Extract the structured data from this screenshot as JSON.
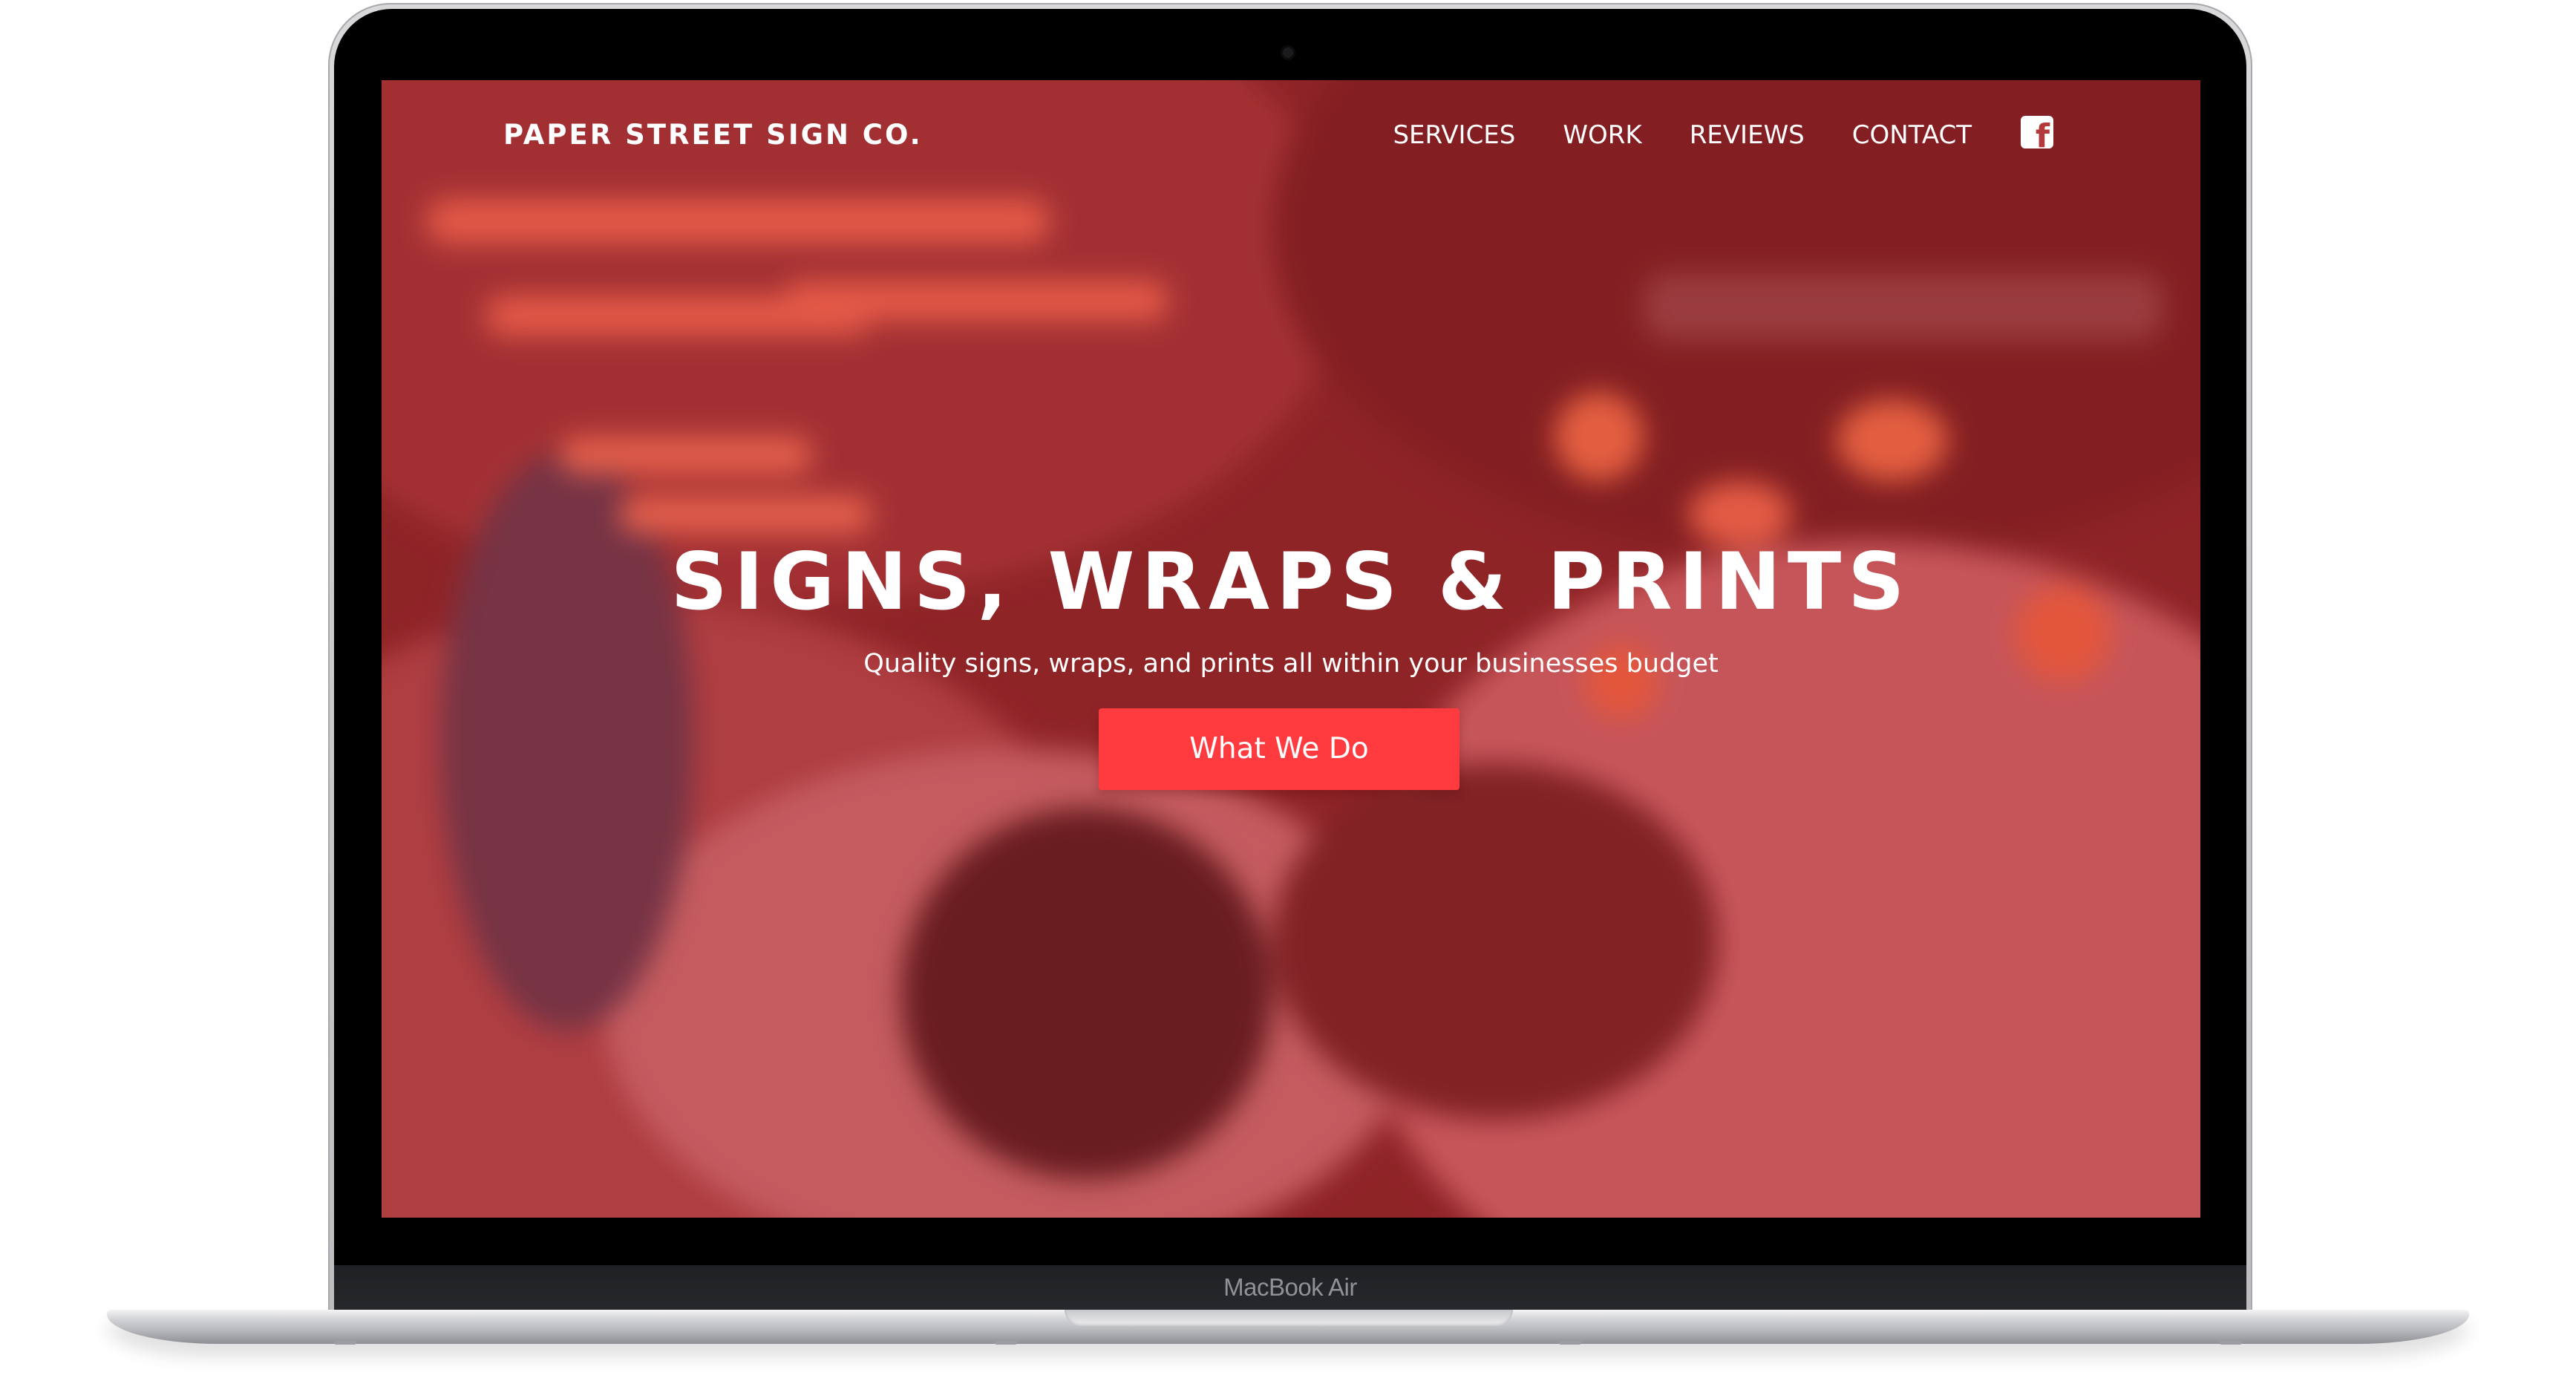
{
  "device": {
    "label": "MacBook Air"
  },
  "website": {
    "logo": "PAPER STREET SIGN CO.",
    "nav": [
      {
        "label": "SERVICES"
      },
      {
        "label": "WORK"
      },
      {
        "label": "REVIEWS"
      },
      {
        "label": "CONTACT"
      }
    ],
    "social_icon": "facebook-icon",
    "hero": {
      "title": "SIGNS, WRAPS & PRINTS",
      "subtitle": "Quality signs, wraps, and prints all within your businesses budget",
      "cta_label": "What We Do"
    },
    "colors": {
      "overlay": "#c42e34",
      "cta": "#ff3b3f",
      "text": "#ffffff"
    }
  }
}
